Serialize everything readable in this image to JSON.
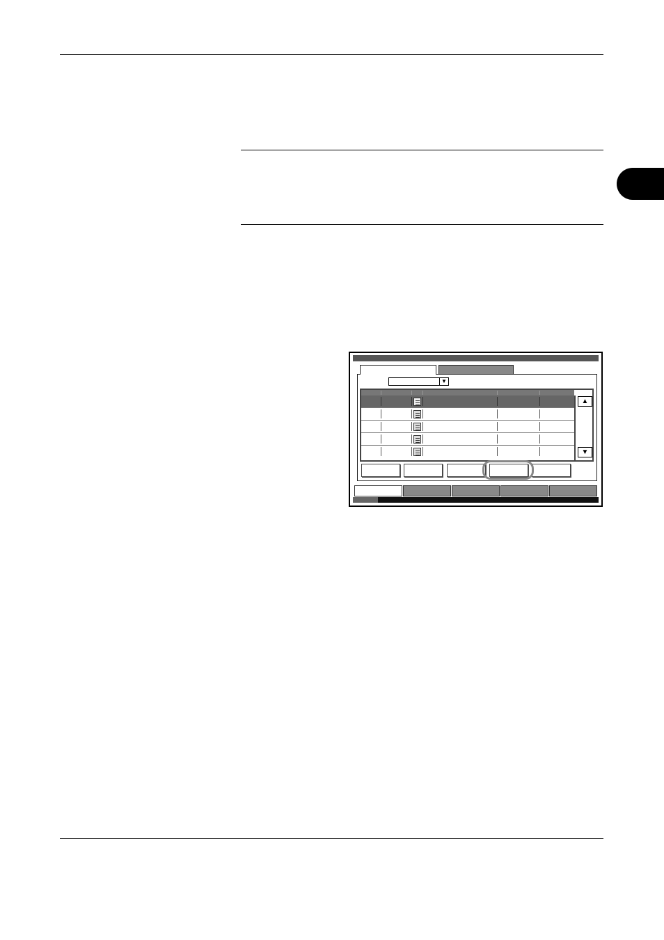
{
  "page": {
    "rules": [
      "header-rule",
      "note-top-rule",
      "note-bottom-rule",
      "footer-rule"
    ]
  },
  "panel": {
    "tabs": [
      "",
      ""
    ],
    "dropdown_value": "",
    "dropdown_arrow": "▼",
    "list": {
      "rows": [
        {
          "selected": true
        },
        {
          "selected": false
        },
        {
          "selected": false
        },
        {
          "selected": false
        },
        {
          "selected": false
        }
      ],
      "scroll_up": "▲",
      "scroll_down": "▼"
    },
    "buttons": [
      "",
      "",
      "",
      "",
      ""
    ],
    "highlighted_button_index": 3,
    "bottom_tabs": [
      "",
      "",
      "",
      "",
      ""
    ],
    "active_bottom_tab_index": 0
  },
  "colors": {
    "selected_row": "#666666",
    "inactive_tab": "#888888",
    "highlight_ring": "#888888"
  }
}
